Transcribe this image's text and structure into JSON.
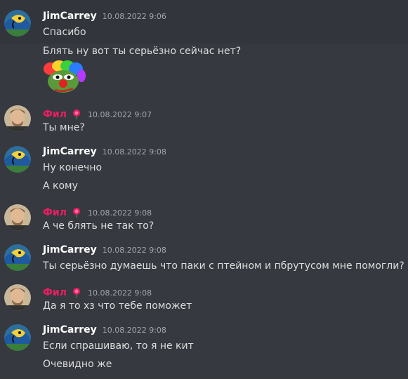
{
  "messages": [
    {
      "author": "JimCarrey",
      "timestamp": "10.08.2022 9:06",
      "lines": [
        "Спасибо",
        "Блять ну вот ты серьёзно сейчас нет?"
      ],
      "has_emoji": true,
      "emoji": "clown-pepe-emoji"
    },
    {
      "author": "Фил",
      "timestamp": "10.08.2022 9:07",
      "lines": [
        "Ты мне?"
      ],
      "role_icon": "rose-icon"
    },
    {
      "author": "JimCarrey",
      "timestamp": "10.08.2022 9:08",
      "lines": [
        "Ну конечно",
        "А кому"
      ]
    },
    {
      "author": "Фил",
      "timestamp": "10.08.2022 9:08",
      "lines": [
        "А че блять не так то?"
      ],
      "role_icon": "rose-icon"
    },
    {
      "author": "JimCarrey",
      "timestamp": "10.08.2022 9:08",
      "lines": [
        "Ты серьёзно думаешь что паки с птейном и пбрутусом мне помогли?"
      ]
    },
    {
      "author": "Фил",
      "timestamp": "10.08.2022 9:08",
      "lines": [
        "Да я то хз что тебе поможет"
      ],
      "role_icon": "rose-icon"
    },
    {
      "author": "JimCarrey",
      "timestamp": "10.08.2022 9:08",
      "lines": [
        "Если спрашиваю, то я не кит",
        "Очевидно же"
      ]
    }
  ],
  "colors": {
    "background": "#36393f",
    "highlight": "#32353b",
    "username_jim": "#ffffff",
    "username_fil": "#e91e63",
    "timestamp": "#a3a6aa",
    "message_text": "#dcddde"
  }
}
